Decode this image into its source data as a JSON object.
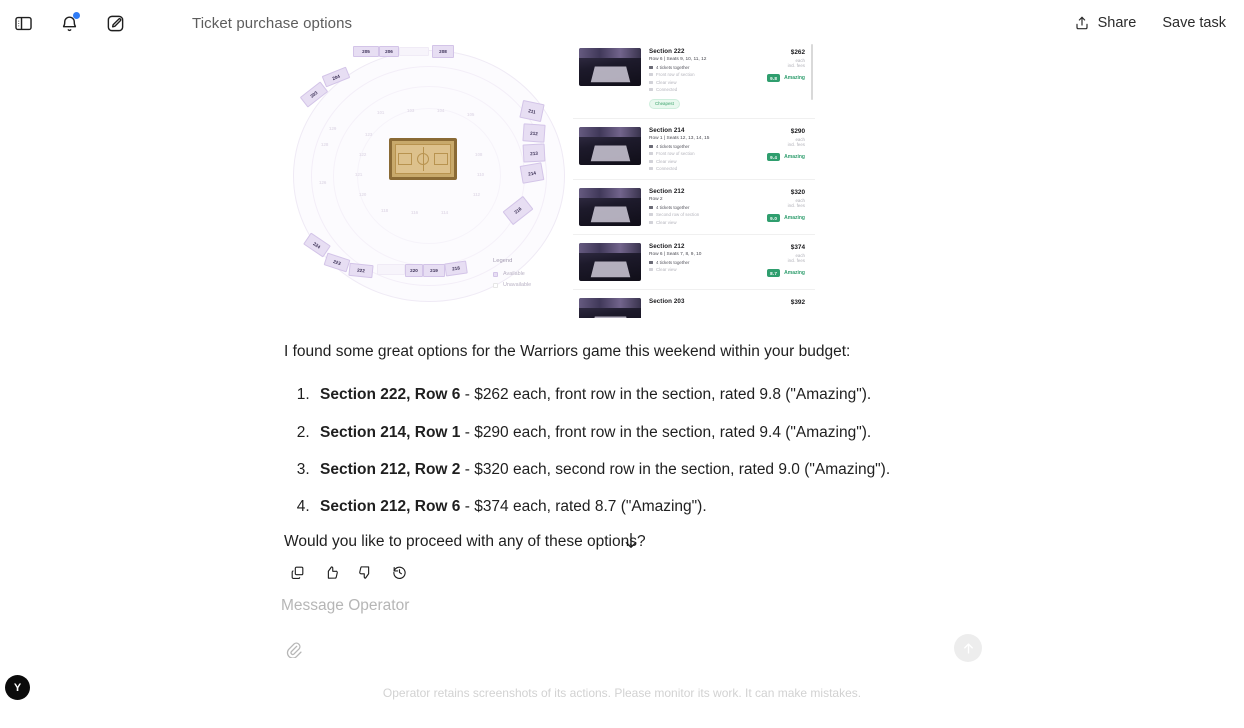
{
  "header": {
    "sidebar_toggle_icon": "sidebar-toggle-icon",
    "notifications_icon": "bell-icon",
    "compose_icon": "compose-icon",
    "title": "Ticket purchase options",
    "share_label": "Share",
    "share_icon": "share-upload-icon",
    "save_task_label": "Save task"
  },
  "screenshot": {
    "seatmap": {
      "legend_title": "Legend",
      "legend_collapse_icon": "chevron-down-icon",
      "legend_available": "Available",
      "legend_unavailable": "Unavailable",
      "available_color": "#e7def3",
      "court_color": "#ddc18c",
      "highlighted_sections": [
        "203",
        "204",
        "205",
        "206",
        "208",
        "211",
        "212",
        "213",
        "214",
        "216",
        "222",
        "223",
        "224",
        "220",
        "219",
        "218"
      ]
    },
    "listings": [
      {
        "section": "Section 222",
        "row_seats": "Row 6 | Seats 9, 10, 11, 12",
        "features": [
          "4 tickets together",
          "Front row of section",
          "Clear view",
          "Connected"
        ],
        "badge": "Cheapest",
        "price": "$262",
        "price_note": "each",
        "fees_note": "incl. fees",
        "rating": "9.8",
        "rating_label": "Amazing"
      },
      {
        "section": "Section 214",
        "row_seats": "Row 1 | Seats 12, 13, 14, 15",
        "features": [
          "4 tickets together",
          "Front row of section",
          "Clear view",
          "Connected"
        ],
        "badge": "",
        "price": "$290",
        "price_note": "each",
        "fees_note": "incl. fees",
        "rating": "9.4",
        "rating_label": "Amazing"
      },
      {
        "section": "Section 212",
        "row_seats": "Row 2",
        "features": [
          "4 tickets together",
          "Second row of section",
          "Clear view"
        ],
        "badge": "",
        "price": "$320",
        "price_note": "each",
        "fees_note": "incl. fees",
        "rating": "9.0",
        "rating_label": "Amazing"
      },
      {
        "section": "Section 212",
        "row_seats": "Row 6 | Seats 7, 8, 9, 10",
        "features": [
          "4 tickets together",
          "Clear view"
        ],
        "badge": "",
        "price": "$374",
        "price_note": "each",
        "fees_note": "incl. fees",
        "rating": "8.7",
        "rating_label": "Amazing"
      },
      {
        "section": "Section 203",
        "row_seats": "",
        "features": [],
        "badge": "",
        "price": "$392",
        "price_note": "",
        "fees_note": "",
        "rating": "",
        "rating_label": ""
      }
    ]
  },
  "message": {
    "intro": "I found some great options for the Warriors game this weekend within your budget:",
    "options": [
      {
        "title": "Section 222, Row 6",
        "detail": " - $262 each, front row in the section, rated 9.8 (\"Amazing\")."
      },
      {
        "title": "Section 214, Row 1",
        "detail": " - $290 each, front row in the section, rated 9.4 (\"Amazing\")."
      },
      {
        "title": "Section 212, Row 2",
        "detail": " - $320 each, second row in the section, rated 9.0 (\"Amazing\")."
      },
      {
        "title": "Section 212, Row 6",
        "detail": " - $374 each, rated 8.7 (\"Amazing\")."
      }
    ],
    "outro": "Would you like to proceed with any of these options?",
    "actions": [
      {
        "name": "copy-icon",
        "label": "Copy"
      },
      {
        "name": "thumbs-up-icon",
        "label": "Good response"
      },
      {
        "name": "thumbs-down-icon",
        "label": "Bad response"
      },
      {
        "name": "history-icon",
        "label": "Regenerate"
      }
    ]
  },
  "scroll_down_icon": "scroll-down-arrow-icon",
  "composer": {
    "placeholder": "Message Operator",
    "value": "",
    "attach_icon": "paperclip-icon",
    "send_icon": "arrow-up-icon"
  },
  "footer": {
    "note": "Operator retains screenshots of its actions. Please monitor its work. It can make mistakes."
  },
  "user": {
    "avatar_initial": "Y"
  }
}
